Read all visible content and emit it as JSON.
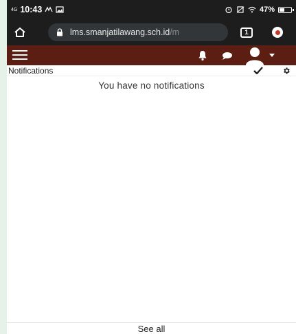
{
  "status_bar": {
    "network": "4G",
    "time": "10:43",
    "battery": "47%"
  },
  "browser": {
    "url_host": "lms.smanjatilawang.sch.id",
    "url_rest": "/m",
    "tab_count": "1"
  },
  "notifications": {
    "title": "Notifications",
    "empty_message": "You have no notifications",
    "see_all": "See all"
  },
  "colors": {
    "header": "#5c1d12",
    "browser_chrome": "#1d1d1d"
  }
}
